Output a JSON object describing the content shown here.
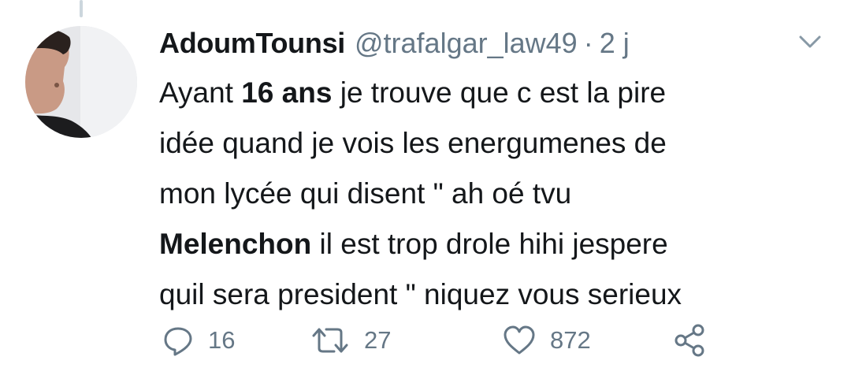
{
  "tweet": {
    "author_name": "AdoumTounsi",
    "handle": "@trafalgar_law49",
    "separator": "·",
    "time": "2 j",
    "lines": [
      {
        "segments": [
          {
            "text": "Ayant ",
            "bold": false
          },
          {
            "text": "16 ans",
            "bold": true
          },
          {
            "text": " je trouve que c est la pire",
            "bold": false
          }
        ]
      },
      {
        "segments": [
          {
            "text": "idée quand je vois les energumenes de",
            "bold": false
          }
        ]
      },
      {
        "segments": [
          {
            "text": "mon lycée qui disent \" ah oé tvu",
            "bold": false
          }
        ]
      },
      {
        "segments": [
          {
            "text": "Melenchon",
            "bold": true
          },
          {
            "text": " il est trop drole hihi jespere",
            "bold": false
          }
        ]
      },
      {
        "segments": [
          {
            "text": "quil sera president \" niquez vous serieux",
            "bold": false
          }
        ]
      }
    ]
  },
  "actions": {
    "reply": {
      "icon": "reply-icon",
      "count": "16"
    },
    "retweet": {
      "icon": "retweet-icon",
      "count": "27"
    },
    "like": {
      "icon": "heart-icon",
      "count": "872"
    },
    "share": {
      "icon": "share-icon"
    }
  },
  "colors": {
    "text": "#14171a",
    "secondary": "#657786",
    "thread_line": "#ccd6dd",
    "background": "#ffffff"
  }
}
